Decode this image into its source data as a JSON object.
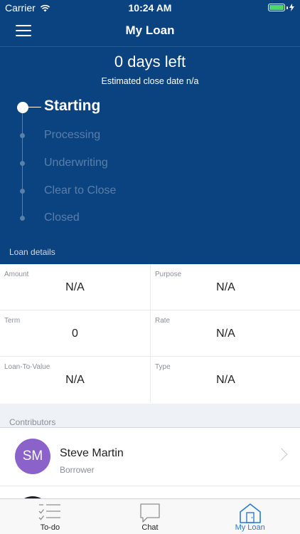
{
  "status_bar": {
    "carrier": "Carrier",
    "time": "10:24 AM"
  },
  "nav": {
    "title": "My Loan"
  },
  "summary": {
    "days_left": "0 days left",
    "close_date": "Estimated close date n/a"
  },
  "steps": [
    {
      "label": "Starting",
      "active": true
    },
    {
      "label": "Processing",
      "active": false
    },
    {
      "label": "Underwriting",
      "active": false
    },
    {
      "label": "Clear to Close",
      "active": false
    },
    {
      "label": "Closed",
      "active": false
    }
  ],
  "loan_details": {
    "section_label": "Loan details",
    "fields": [
      {
        "label": "Amount",
        "value": "N/A"
      },
      {
        "label": "Purpose",
        "value": "N/A"
      },
      {
        "label": "Term",
        "value": "0"
      },
      {
        "label": "Rate",
        "value": "N/A"
      },
      {
        "label": "Loan-To-Value",
        "value": "N/A"
      },
      {
        "label": "Type",
        "value": "N/A"
      }
    ]
  },
  "contributors": {
    "section_label": "Contributors",
    "items": [
      {
        "initials": "SM",
        "name": "Steve Martin",
        "role": "Borrower"
      }
    ]
  },
  "tabs": [
    {
      "label": "To-do",
      "icon": "todo-list-icon"
    },
    {
      "label": "Chat",
      "icon": "chat-bubble-icon"
    },
    {
      "label": "My Loan",
      "icon": "house-icon"
    }
  ],
  "colors": {
    "header_bg": "#0a437f",
    "accent": "#2a7bd1",
    "avatar": "#8b62c9",
    "battery": "#4cd964"
  }
}
